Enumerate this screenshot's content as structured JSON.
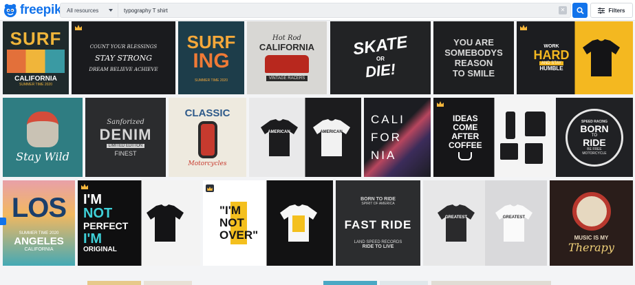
{
  "header": {
    "logo_text": "freepik",
    "resource_select": "All resources",
    "search_query": "typography T shirt",
    "filters_label": "Filters"
  },
  "colors": {
    "brand": "#1273eb",
    "premium": "#f6b73c"
  },
  "icons": [
    "freepik-logo-icon",
    "chevron-down-icon",
    "clear-icon",
    "search-icon",
    "filters-icon",
    "premium-crown-icon"
  ],
  "results": {
    "row1": [
      {
        "name": "surf-california",
        "lines": [
          "SURF",
          "CALIFORNIA",
          "SUMMER TIME 2020"
        ]
      },
      {
        "name": "quotes-grid",
        "lines": [
          "COUNT YOUR BLESSINGS",
          "STAY STRONG",
          "DREAM BELIEVE ACHIEVE"
        ]
      },
      {
        "name": "surfing",
        "lines": [
          "SURF",
          "ING",
          "SUMMER TIME 2020"
        ]
      },
      {
        "name": "hot-rod",
        "lines": [
          "Hot Rod",
          "CALIFORNIA",
          "VINTAGE RACERS"
        ]
      },
      {
        "name": "skate-or-die",
        "lines": [
          "SKATE",
          "OR",
          "DIE!"
        ]
      },
      {
        "name": "you-are-somebodys",
        "lines": [
          "YOU ARE",
          "SOMEBODYS",
          "REASON",
          "TO SMILE"
        ]
      },
      {
        "name": "work-hard",
        "lines": [
          "WORK",
          "HARD",
          "AND STAY",
          "HUMBLE"
        ]
      }
    ],
    "row2": [
      {
        "name": "stay-wild",
        "lines": [
          "Stay Wild"
        ]
      },
      {
        "name": "denim",
        "lines": [
          "Sanforized",
          "DENIM",
          "LIMITED EDITION",
          "FINEST"
        ]
      },
      {
        "name": "classic-motorcycles",
        "lines": [
          "CLASSIC",
          "Motorcycles"
        ]
      },
      {
        "name": "american",
        "lines": [
          "AMERICAN",
          "AMERICAN"
        ]
      },
      {
        "name": "california-vertical",
        "lines": [
          "CALI",
          "FOR",
          "NIA"
        ]
      },
      {
        "name": "ideas-come-after-coffee",
        "lines": [
          "IDEAS",
          "COME",
          "AFTER",
          "COFFEE"
        ]
      },
      {
        "name": "born-to-ride",
        "lines": [
          "SPEED RACING",
          "BORN",
          "TO",
          "RIDE",
          "BE FREE",
          "MOTORCYCLE"
        ]
      }
    ],
    "row3": [
      {
        "name": "los-angeles",
        "lines": [
          "LOS",
          "SUMMER TIME 2020",
          "ANGELES",
          "CALIFORNIA"
        ]
      },
      {
        "name": "im-not-perfect",
        "lines": [
          "I'M",
          "NOT",
          "PERFECT",
          "I'M",
          "ORIGINAL"
        ]
      },
      {
        "name": "im-not-over",
        "lines": [
          "\"I'M",
          "NOT",
          "OVER\""
        ]
      },
      {
        "name": "fast-ride",
        "lines": [
          "BORN TO RIDE",
          "SPIRIT OF AMERICA",
          "FAST RIDE",
          "LAND SPEED RECORDS",
          "RIDE TO LIVE"
        ]
      },
      {
        "name": "greatest",
        "lines": [
          "GREATEST",
          "GREATEST"
        ]
      },
      {
        "name": "music-therapy",
        "lines": [
          "MUSIC IS MY",
          "Therapy"
        ]
      }
    ]
  }
}
